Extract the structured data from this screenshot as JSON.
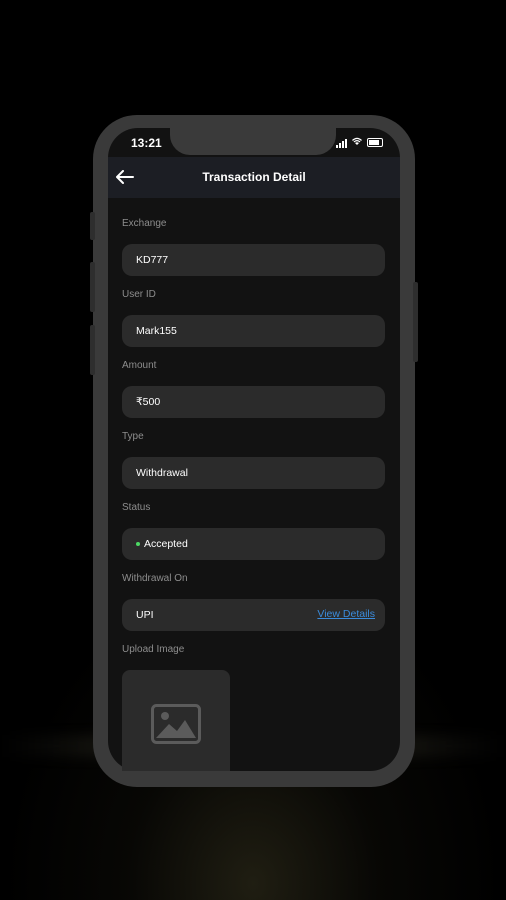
{
  "status_bar": {
    "time": "13:21"
  },
  "header": {
    "title": "Transaction Detail"
  },
  "fields": [
    {
      "label": "Exchange",
      "value": "KD777"
    },
    {
      "label": "User ID",
      "value": "Mark155"
    },
    {
      "label": "Amount",
      "value": "₹500"
    },
    {
      "label": "Type",
      "value": "Withdrawal"
    },
    {
      "label": "Status",
      "value": "Accepted",
      "status_color": "#4cd964"
    },
    {
      "label": "Withdrawal On",
      "value": "UPI",
      "link": "View Details"
    }
  ],
  "upload": {
    "label": "Upload Image"
  },
  "colors": {
    "accent_link": "#3a8bdb",
    "background": "#121212",
    "field_bg": "#2b2b2b"
  }
}
